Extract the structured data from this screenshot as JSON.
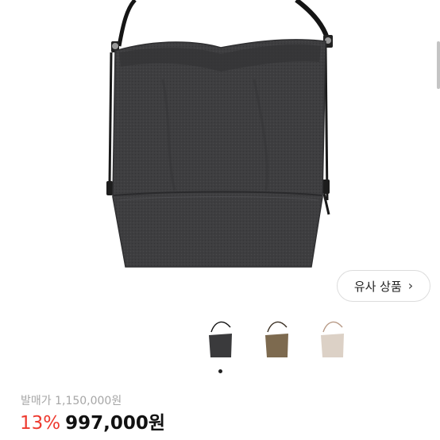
{
  "similar_button": {
    "label": "유사 상품",
    "chevron": "›"
  },
  "variants": [
    {
      "color_name": "charcoal",
      "color": "#3a3a3c",
      "selected": true
    },
    {
      "color_name": "olive-brown",
      "color": "#7d6a4f",
      "selected": false
    },
    {
      "color_name": "beige",
      "color": "#dcd1c6",
      "selected": false
    }
  ],
  "pricing": {
    "list_price": "발매가 1,150,000원",
    "discount": "13%",
    "sale_price": "997,000원"
  },
  "colors": {
    "discount": "#ee3a2f",
    "bag_main": "#3d3d3f",
    "strap": "#151515"
  }
}
